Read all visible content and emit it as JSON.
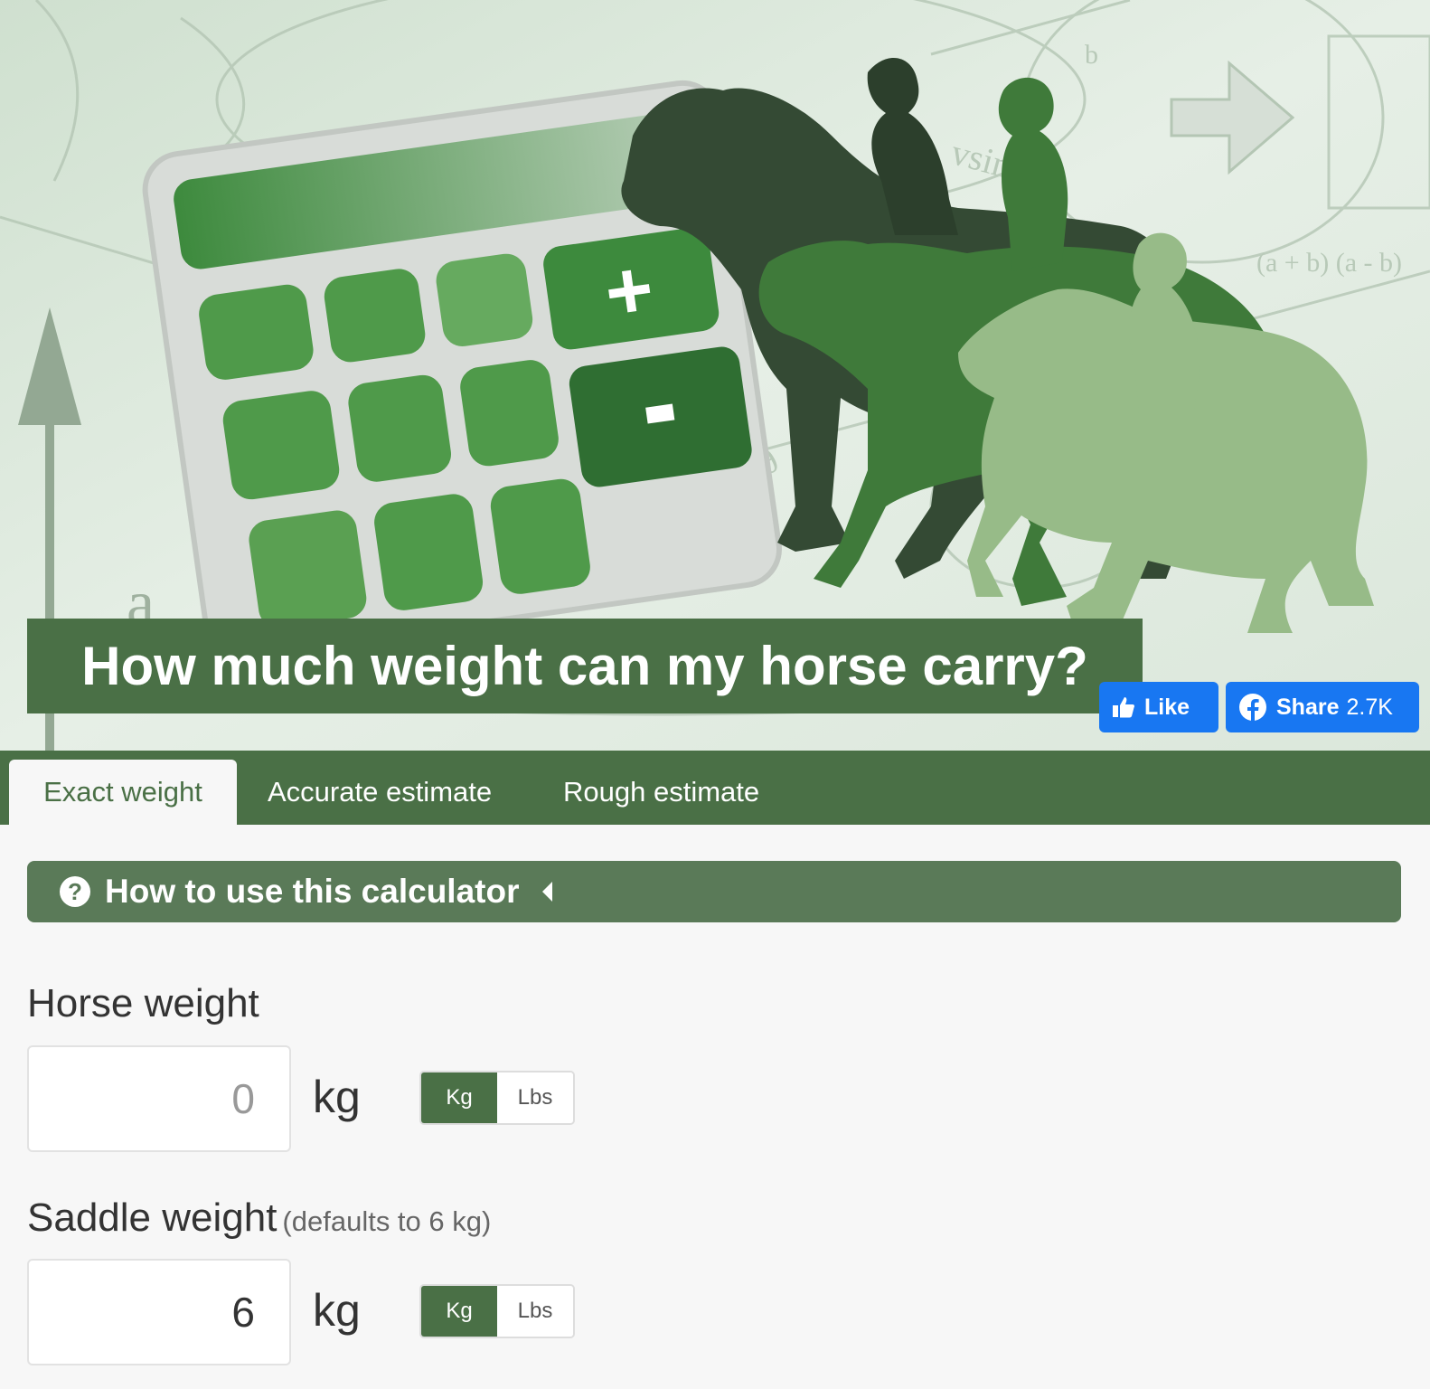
{
  "hero": {
    "title": "How much weight can my horse carry?",
    "like_label": "Like",
    "share_label": "Share",
    "share_count": "2.7K"
  },
  "tabs": [
    {
      "label": "Exact weight",
      "active": true
    },
    {
      "label": "Accurate estimate",
      "active": false
    },
    {
      "label": "Rough estimate",
      "active": false
    }
  ],
  "howto": {
    "label": "How to use this calculator"
  },
  "horse_weight": {
    "label": "Horse weight",
    "placeholder": "0",
    "unit": "kg",
    "toggle": {
      "kg": "Kg",
      "lbs": "Lbs",
      "selected": "Kg"
    }
  },
  "saddle_weight": {
    "label": "Saddle weight",
    "hint": "(defaults to 6 kg)",
    "value": "6",
    "unit": "kg",
    "toggle": {
      "kg": "Kg",
      "lbs": "Lbs",
      "selected": "Kg"
    }
  },
  "colors": {
    "brand_green": "#4a7046",
    "facebook_blue": "#1877f2"
  }
}
